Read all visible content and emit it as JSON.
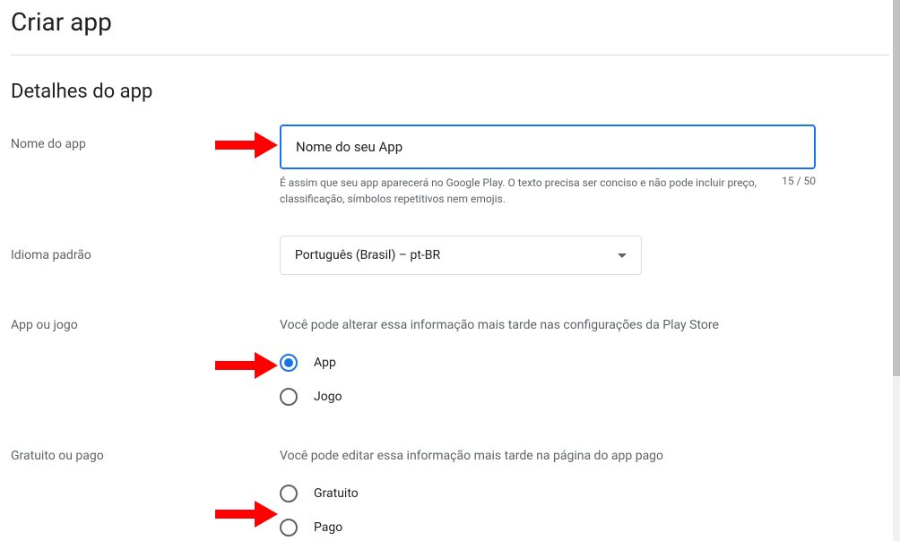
{
  "page": {
    "title": "Criar app"
  },
  "section": {
    "title": "Detalhes do app"
  },
  "fields": {
    "appName": {
      "label": "Nome do app",
      "value": "Nome do seu App",
      "helper": "É assim que seu app aparecerá no Google Play. O texto precisa ser conciso e não pode incluir preço, classificação, símbolos repetitivos nem emojis.",
      "count": "15 / 50"
    },
    "language": {
      "label": "Idioma padrão",
      "selected": "Português (Brasil) – pt-BR"
    },
    "appOrGame": {
      "label": "App ou jogo",
      "info": "Você pode alterar essa informação mais tarde nas configurações da Play Store",
      "options": {
        "app": "App",
        "game": "Jogo"
      }
    },
    "freeOrPaid": {
      "label": "Gratuito ou pago",
      "info": "Você pode editar essa informação mais tarde na página do app pago",
      "options": {
        "free": "Gratuito",
        "paid": "Pago"
      }
    }
  }
}
